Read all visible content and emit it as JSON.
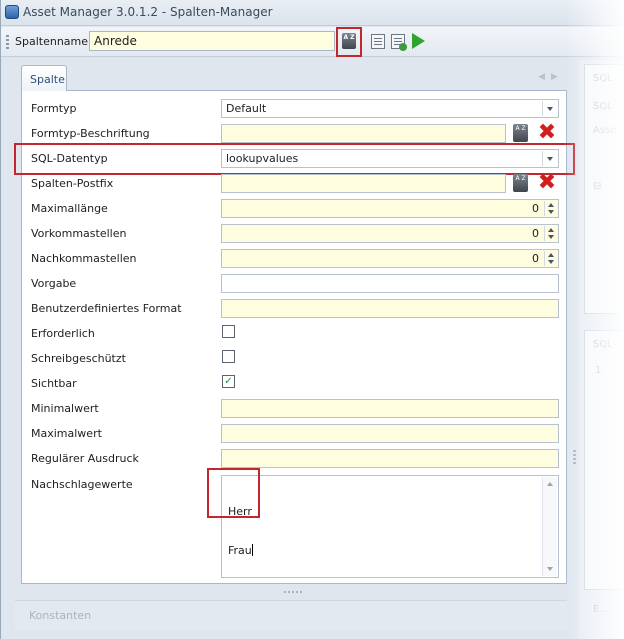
{
  "window": {
    "title": "Asset Manager 3.0.1.2 - Spalten-Manager"
  },
  "toolbar": {
    "spaltenname_label": "Spaltenname:",
    "spaltenname_value": "Anrede",
    "sort_icon_text": "A Z",
    "icons": [
      "sort-az-icon",
      "properties-icon",
      "validate-icon",
      "run-icon"
    ]
  },
  "tab": {
    "label": "Spalte",
    "nav_left": "◀",
    "nav_right": "▶"
  },
  "properties": {
    "formtyp": {
      "label": "Formtyp",
      "value": "Default"
    },
    "formtyp_beschriftung": {
      "label": "Formtyp-Beschriftung",
      "value": ""
    },
    "sql_datentyp": {
      "label": "SQL-Datentyp",
      "value": "lookupvalues"
    },
    "spalten_postfix": {
      "label": "Spalten-Postfix",
      "value": ""
    },
    "maximallaenge": {
      "label": "Maximallänge",
      "value": "0"
    },
    "vorkommastellen": {
      "label": "Vorkommastellen",
      "value": "0"
    },
    "nachkommastellen": {
      "label": "Nachkommastellen",
      "value": "0"
    },
    "vorgabe": {
      "label": "Vorgabe",
      "value": ""
    },
    "benutzerdefiniertes_format": {
      "label": "Benutzerdefiniertes Format",
      "value": ""
    },
    "erforderlich": {
      "label": "Erforderlich",
      "checked": false
    },
    "schreibgeschuetzt": {
      "label": "Schreibgeschützt",
      "checked": false
    },
    "sichtbar": {
      "label": "Sichtbar",
      "checked": true,
      "check_glyph": "✓"
    },
    "minimalwert": {
      "label": "Minimalwert",
      "value": ""
    },
    "maximalwert": {
      "label": "Maximalwert",
      "value": ""
    },
    "regulaerer_ausdruck": {
      "label": "Regulärer Ausdruck",
      "value": ""
    },
    "nachschlagewerte": {
      "label": "Nachschlagewerte",
      "value_line1": "Herr",
      "value_line2": "Frau"
    }
  },
  "sort_icon_small_text": "A Z",
  "delete_glyph": "✖",
  "right_panel": {
    "header1": "SQL",
    "field1": "SQL",
    "field2": "Asse",
    "tree_toggle": "⊟",
    "header2": "SQL-",
    "line_number": "1",
    "footer": "E..."
  },
  "bottom": {
    "label": "Konstanten"
  },
  "colors": {
    "highlight": "#c0282d",
    "field_bg": "#fffde0",
    "check": "#2a8a3a",
    "delete": "#d11f1f",
    "run": "#2fa52f"
  }
}
